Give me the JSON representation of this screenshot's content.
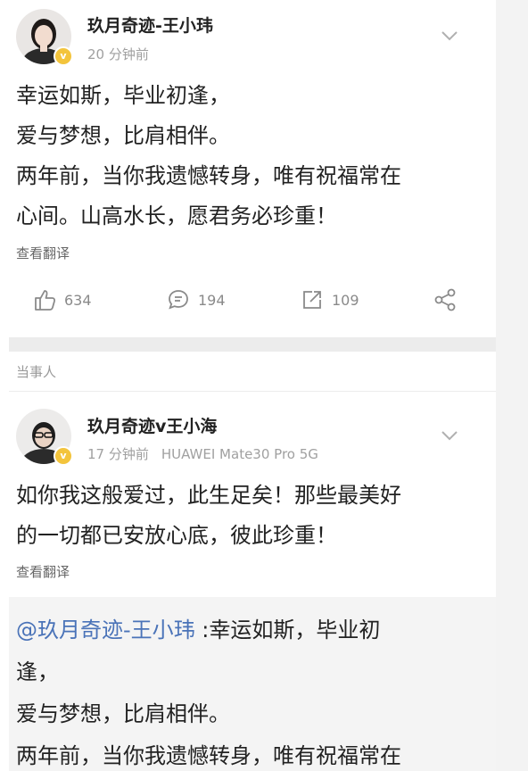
{
  "post1": {
    "username": "玖月奇迹-王小玮",
    "time": "20 分钟前",
    "lines": [
      "幸运如斯，毕业初逢，",
      "爱与梦想，比肩相伴。",
      "两年前，当你我遗憾转身，唯有祝福常在",
      "心间。山高水长，愿君务必珍重！"
    ],
    "translate": "查看翻译",
    "likes": "634",
    "comments": "194",
    "reposts": "109"
  },
  "section_label": "当事人",
  "post2": {
    "username": "玖月奇迹v王小海",
    "time": "17 分钟前",
    "device": "HUAWEI Mate30 Pro 5G",
    "lines": [
      "如你我这般爱过，此生足矣！那些最美好",
      "的一切都已安放心底，彼此珍重！"
    ],
    "translate": "查看翻译",
    "quote_mention": "@玖月奇迹-王小玮",
    "quote_first": " :幸运如斯，毕业初",
    "quote_lines": [
      "逢，",
      "爱与梦想，比肩相伴。",
      "两年前，当你我遗憾转身，唯有祝福常在"
    ]
  },
  "colors": {
    "link": "#4a73b8",
    "badge": "#f3c43c"
  }
}
